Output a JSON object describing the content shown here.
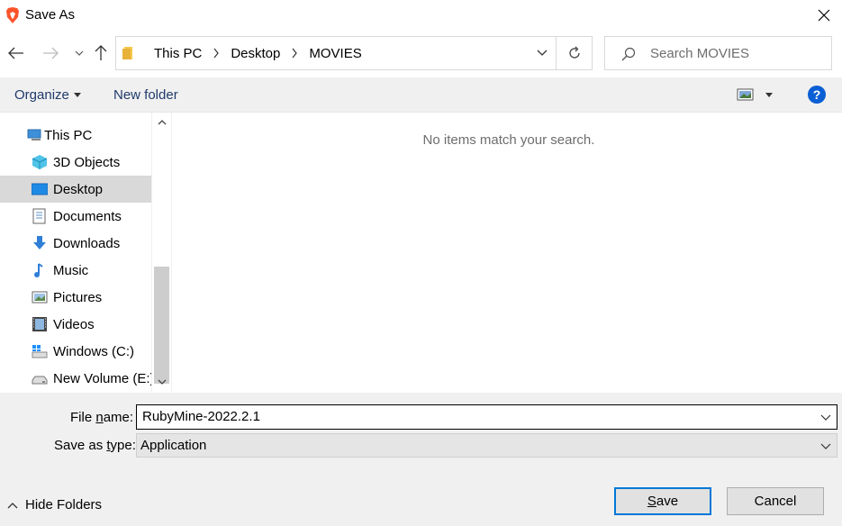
{
  "window": {
    "title": "Save As"
  },
  "address": {
    "crumbs": [
      "This PC",
      "Desktop",
      "MOVIES"
    ]
  },
  "search": {
    "placeholder": "Search MOVIES"
  },
  "toolbar": {
    "organize_label": "Organize",
    "new_folder_label": "New folder",
    "help_label": "?"
  },
  "sidebar": {
    "items": [
      {
        "label": "This PC",
        "icon": "computer-icon"
      },
      {
        "label": "3D Objects",
        "icon": "cube-icon"
      },
      {
        "label": "Desktop",
        "icon": "desktop-icon",
        "selected": true
      },
      {
        "label": "Documents",
        "icon": "document-icon"
      },
      {
        "label": "Downloads",
        "icon": "download-icon"
      },
      {
        "label": "Music",
        "icon": "music-icon"
      },
      {
        "label": "Pictures",
        "icon": "pictures-icon"
      },
      {
        "label": "Videos",
        "icon": "videos-icon"
      },
      {
        "label": "Windows (C:)",
        "icon": "windows-drive-icon"
      },
      {
        "label": "New Volume (E:)",
        "icon": "drive-icon"
      }
    ]
  },
  "content": {
    "empty_message": "No items match your search."
  },
  "footer": {
    "file_name_label_pre": "File ",
    "file_name_label_ul": "n",
    "file_name_label_post": "ame:",
    "file_name_value": "RubyMine-2022.2.1",
    "save_type_label_pre": "Save as ",
    "save_type_label_ul": "t",
    "save_type_label_post": "ype:",
    "save_type_value": "Application",
    "hide_folders_label": "Hide Folders",
    "save_label_ul": "S",
    "save_label_post": "ave",
    "cancel_label": "Cancel"
  },
  "colors": {
    "accent": "#0078d7",
    "help": "#0a5fd4",
    "selected": "#d9d9d9"
  }
}
